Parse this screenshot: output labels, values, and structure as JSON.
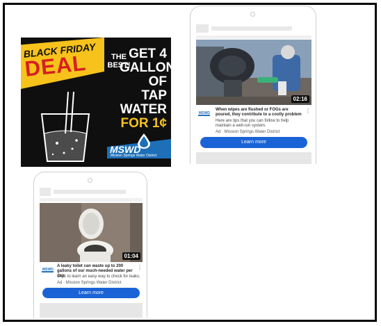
{
  "banner": {
    "black_friday": "BLACK FRIDAY",
    "deal": "DEAL",
    "the_best": "THE BEST!",
    "offer_line1": "GET 4",
    "offer_line2": "GALLONS",
    "offer_line3": "OF TAP",
    "offer_line4": "WATER",
    "offer_price": "FOR 1¢",
    "logo_text": "MSWD",
    "logo_subtext": "Mission Springs Water District"
  },
  "ad_one": {
    "duration": "02:16",
    "logo_text": "MSWD",
    "title": "When wipes are flushed or FOGs are poured, they contribute to a costly problem",
    "description": "Here are tips that you can follow to help maintain a well-run system.",
    "meta": "Ad · Mission Springs Water District",
    "cta": "Learn more"
  },
  "ad_two": {
    "duration": "01:04",
    "logo_text": "MSWD",
    "title": "A leaky toilet can waste up to 200 gallons of our much-needed water per day.",
    "description": "Click to learn an easy way to check for leaks.",
    "meta": "Ad · Mission Springs Water District",
    "cta": "Learn more"
  },
  "colors": {
    "accent_blue": "#1a63d6",
    "banner_yellow": "#f6c21b",
    "banner_red": "#d62020",
    "brand_blue": "#1d6fb8"
  }
}
